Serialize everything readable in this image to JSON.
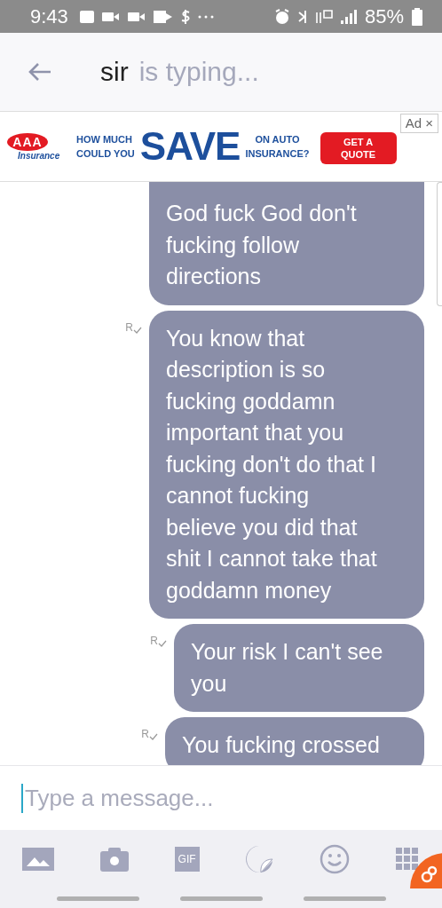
{
  "status_bar": {
    "time": "9:43",
    "battery": "85%"
  },
  "header": {
    "name": "sir",
    "status": "is typing..."
  },
  "ad": {
    "logo": "AAA",
    "logo_sub": "Insurance",
    "line_1": "HOW MUCH",
    "line_2": "COULD YOU",
    "headline": "SAVE",
    "line_3": "ON AUTO",
    "line_4": "INSURANCE?",
    "cta_1": "GET A",
    "cta_2": "QUOTE",
    "badge": "Ad",
    "close": "×"
  },
  "messages": [
    {
      "lines": [
        "God fuck God don't",
        "fucking follow",
        "directions"
      ]
    },
    {
      "lines": [
        "You know that",
        "description is so",
        "fucking goddamn",
        "important that you",
        "fucking don't do that I",
        "cannot fucking",
        "believe you did that",
        "shit I cannot take that",
        "goddamn money"
      ],
      "receipt": "R"
    },
    {
      "lines": [
        "Your risk I can't see",
        "you"
      ],
      "receipt": "R"
    },
    {
      "lines": [
        "You fucking crossed"
      ],
      "receipt": "R"
    }
  ],
  "composer": {
    "placeholder": "Type a message..."
  },
  "toolbar": {
    "gif": "GIF"
  }
}
